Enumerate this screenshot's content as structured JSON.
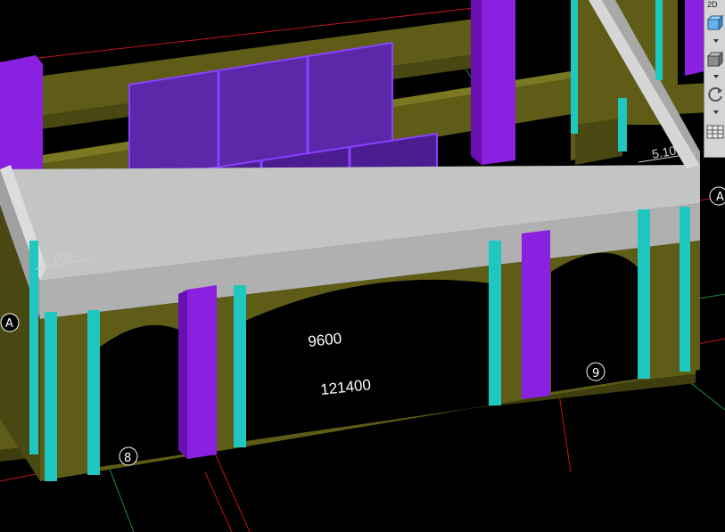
{
  "viewport": {
    "dimensions": {
      "span": "9600",
      "total": "121400"
    },
    "elevations": {
      "left": "5.100",
      "right": "5.10"
    },
    "axis_labels": {
      "a_left": "A",
      "a_right": "A",
      "grid_8": "8",
      "grid_9": "9"
    },
    "colors": {
      "background": "#000000",
      "beam": "#5e5c16",
      "column_purple": "#8a20e0",
      "glass": "#5a28a8",
      "parapet": "#c4c4c4",
      "rebar_cyan": "#1ec8c0",
      "grid_red": "#c01818",
      "grid_green": "#1e8a3a"
    }
  },
  "toolbar": {
    "top_label": "2D",
    "buttons": [
      {
        "icon": "front-view-cube-icon"
      },
      {
        "icon": "3d-box-view-icon"
      },
      {
        "icon": "orbit-rotate-icon"
      },
      {
        "icon": "layout-grid-icon"
      }
    ]
  }
}
